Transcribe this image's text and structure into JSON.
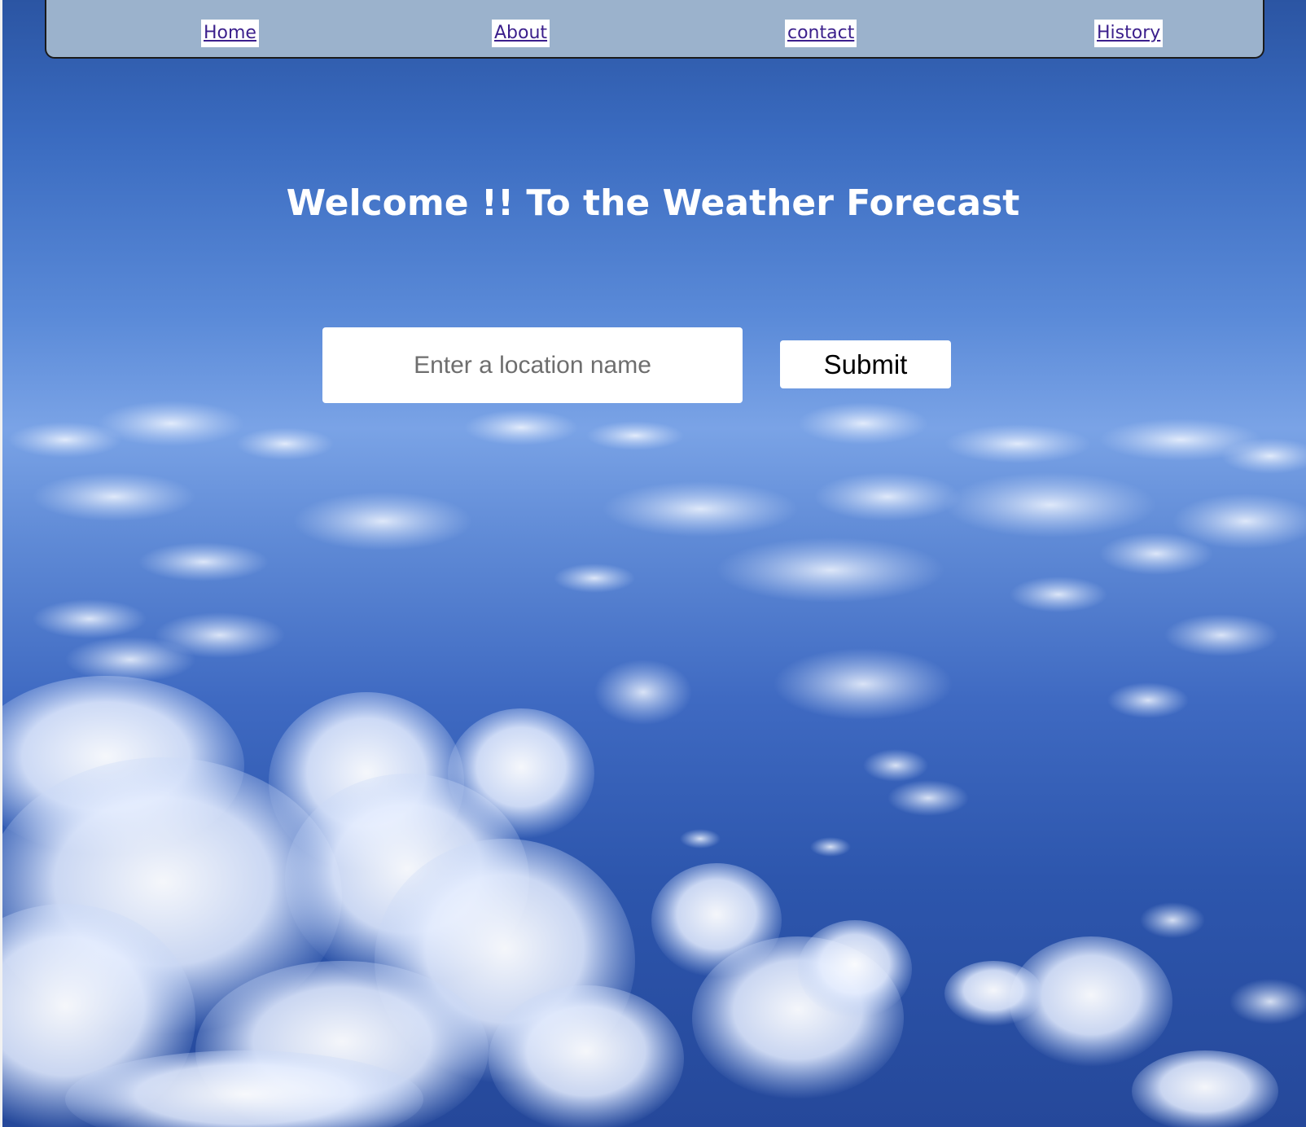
{
  "nav": {
    "items": [
      {
        "label": "Home"
      },
      {
        "label": "About"
      },
      {
        "label": "contact"
      },
      {
        "label": "History"
      }
    ]
  },
  "main": {
    "heading": "Welcome !! To the Weather Forecast",
    "search": {
      "placeholder": "Enter a location name",
      "value": ""
    },
    "submit_label": "Submit"
  },
  "colors": {
    "navbar_bg": "#9bb2cc",
    "link": "#3b1f8c",
    "sky_top": "#2b55a3",
    "sky_horizon": "#7aa3e6",
    "sky_bottom": "#25489a"
  },
  "background": {
    "image_subject": "aerial view of clouds over blue sky"
  }
}
